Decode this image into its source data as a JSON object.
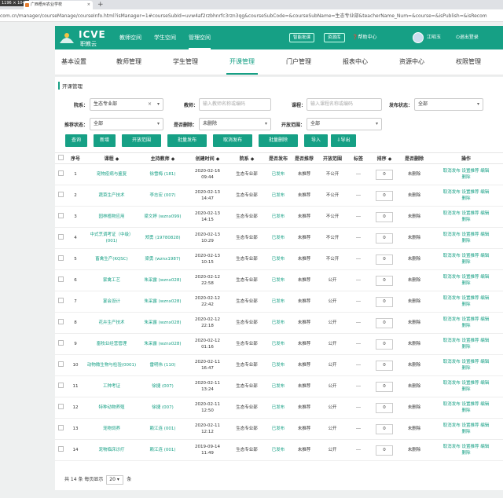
{
  "browser": {
    "dimensions_badge": "1196 × 1047",
    "tab_title": "广西梧州农业学校",
    "url": "com.cn/manager/courseManage/courseInfo.html?isManager=1#courseSubId=uvw4af2rzbhnrfc3rzn3qg&courseSubCode=&courseSubName=生态专业部&teacherName_Num=&course=&isPublish=&isRecom"
  },
  "header": {
    "logo_main": "ICVE",
    "logo_sub": "职教云",
    "nav": [
      "教师空间",
      "学生空间",
      "管理空间"
    ],
    "active_nav": "管理空间",
    "pills": [
      "智能批课",
      "资源库"
    ],
    "help": "帮助中心",
    "user": "江昭玉",
    "logout": "退出登录",
    "colors": {
      "primary": "#16a085"
    }
  },
  "subnav": {
    "items": [
      "基本设置",
      "教师管理",
      "学生管理",
      "开课管理",
      "门户管理",
      "报表中心",
      "资源中心",
      "权限管理"
    ],
    "active": "开课管理"
  },
  "section_title": "开课管理",
  "filters": {
    "dept_label": "院系：",
    "dept_value": "生态专业部",
    "teacher_label": "教师：",
    "teacher_placeholder": "输入教师名称或编码",
    "course_label": "课程：",
    "course_placeholder": "输入课程名称或编码",
    "publish_label": "发布状态：",
    "publish_value": "全部",
    "recommend_label": "推荐状态：",
    "recommend_value": "全部",
    "deleted_label": "是否删除：",
    "deleted_value": "未删除",
    "scope_label": "开放范围：",
    "scope_value": "全部"
  },
  "buttons": [
    "查询",
    "新增",
    "开放范围",
    "批量发布",
    "取消发布",
    "批量删除",
    "导入",
    "导出"
  ],
  "table": {
    "headers": [
      "序号",
      "课程 ◆",
      "主持教师 ◆",
      "创建时间 ◆",
      "院系 ◆",
      "是否发布",
      "是否推荐",
      "开放范围",
      "标签",
      "排序 ◆",
      "是否删除",
      "操作"
    ],
    "rows": [
      {
        "n": "1",
        "course": "宠物疫病与鉴复",
        "teacher": "徐雪梅 (181)",
        "date": "2020-02-16",
        "time": "09:44",
        "dept": "生态专业部",
        "pub": "已发布",
        "rec": "未推荐",
        "scope": "不公开",
        "tag": "---",
        "sort": "0",
        "del": "未删除"
      },
      {
        "n": "2",
        "course": "蔬菜生产技术",
        "teacher": "李志宏 (007)",
        "date": "2020-02-13",
        "time": "14:47",
        "dept": "生态专业部",
        "pub": "已发布",
        "rec": "未推荐",
        "scope": "不公开",
        "tag": "---",
        "sort": "0",
        "del": "未删除"
      },
      {
        "n": "3",
        "course": "园林植物应用",
        "teacher": "梁文婷 (wznx099)",
        "date": "2020-02-13",
        "time": "14:15",
        "dept": "生态专业部",
        "pub": "已发布",
        "rec": "未推荐",
        "scope": "不公开",
        "tag": "---",
        "sort": "0",
        "del": "未删除"
      },
      {
        "n": "4",
        "course": "中式烹调考证（中级）(001)",
        "teacher": "郑勇 (19780828)",
        "date": "2020-02-13",
        "time": "10:29",
        "dept": "生态专业部",
        "pub": "已发布",
        "rec": "未推荐",
        "scope": "不公开",
        "tag": "---",
        "sort": "0",
        "del": "未删除"
      },
      {
        "n": "5",
        "course": "畜禽生产(KQSC)",
        "teacher": "梁勇 (wznx1987)",
        "date": "2020-02-13",
        "time": "10:15",
        "dept": "生态专业部",
        "pub": "已发布",
        "rec": "未推荐",
        "scope": "不公开",
        "tag": "---",
        "sort": "0",
        "del": "未删除"
      },
      {
        "n": "6",
        "course": "家禽工艺",
        "teacher": "朱采露 (wznx028)",
        "date": "2020-02-12",
        "time": "22:58",
        "dept": "生态专业部",
        "pub": "已发布",
        "rec": "未推荐",
        "scope": "公开",
        "tag": "---",
        "sort": "0",
        "del": "未删除"
      },
      {
        "n": "7",
        "course": "宴会设计",
        "teacher": "朱采露 (wznx028)",
        "date": "2020-02-12",
        "time": "22:42",
        "dept": "生态专业部",
        "pub": "已发布",
        "rec": "未推荐",
        "scope": "公开",
        "tag": "---",
        "sort": "0",
        "del": "未删除"
      },
      {
        "n": "8",
        "course": "花卉生产技术",
        "teacher": "朱采露 (wznx028)",
        "date": "2020-02-12",
        "time": "22:18",
        "dept": "生态专业部",
        "pub": "已发布",
        "rec": "未推荐",
        "scope": "公开",
        "tag": "---",
        "sort": "0",
        "del": "未删除"
      },
      {
        "n": "9",
        "course": "畜牧业经营管理",
        "teacher": "朱采露 (wznx028)",
        "date": "2020-02-12",
        "time": "01:16",
        "dept": "生态专业部",
        "pub": "已发布",
        "rec": "未推荐",
        "scope": "公开",
        "tag": "---",
        "sort": "0",
        "del": "未删除"
      },
      {
        "n": "10",
        "course": "动物微生物与检验(0001)",
        "teacher": "雷明伟 (110)",
        "date": "2020-02-11",
        "time": "16:47",
        "dept": "生态专业部",
        "pub": "已发布",
        "rec": "未推荐",
        "scope": "公开",
        "tag": "---",
        "sort": "0",
        "del": "未删除"
      },
      {
        "n": "11",
        "course": "工种考证",
        "teacher": "徐捷 (007)",
        "date": "2020-02-11",
        "time": "13:24",
        "dept": "生态专业部",
        "pub": "已发布",
        "rec": "未推荐",
        "scope": "公开",
        "tag": "---",
        "sort": "0",
        "del": "未删除"
      },
      {
        "n": "12",
        "course": "特种动物养殖",
        "teacher": "徐捷 (007)",
        "date": "2020-02-11",
        "time": "12:50",
        "dept": "生态专业部",
        "pub": "已发布",
        "rec": "未推荐",
        "scope": "公开",
        "tag": "---",
        "sort": "0",
        "del": "未删除"
      },
      {
        "n": "13",
        "course": "宠物饲养",
        "teacher": "赖江连 (001)",
        "date": "2020-02-11",
        "time": "12:12",
        "dept": "生态专业部",
        "pub": "已发布",
        "rec": "未推荐",
        "scope": "公开",
        "tag": "---",
        "sort": "0",
        "del": "未删除"
      },
      {
        "n": "14",
        "course": "宠物临床诊疗",
        "teacher": "赖江连 (001)",
        "date": "2019-09-14",
        "time": "11:49",
        "dept": "生态专业部",
        "pub": "已发布",
        "rec": "未推荐",
        "scope": "公开",
        "tag": "---",
        "sort": "0",
        "del": "未删除"
      }
    ],
    "ops": [
      "取消发布",
      "设置推荐",
      "编辑",
      "删除"
    ]
  },
  "pager": {
    "total_prefix": "共 14 条 每页显示",
    "page_size": "20",
    "suffix": "条"
  }
}
